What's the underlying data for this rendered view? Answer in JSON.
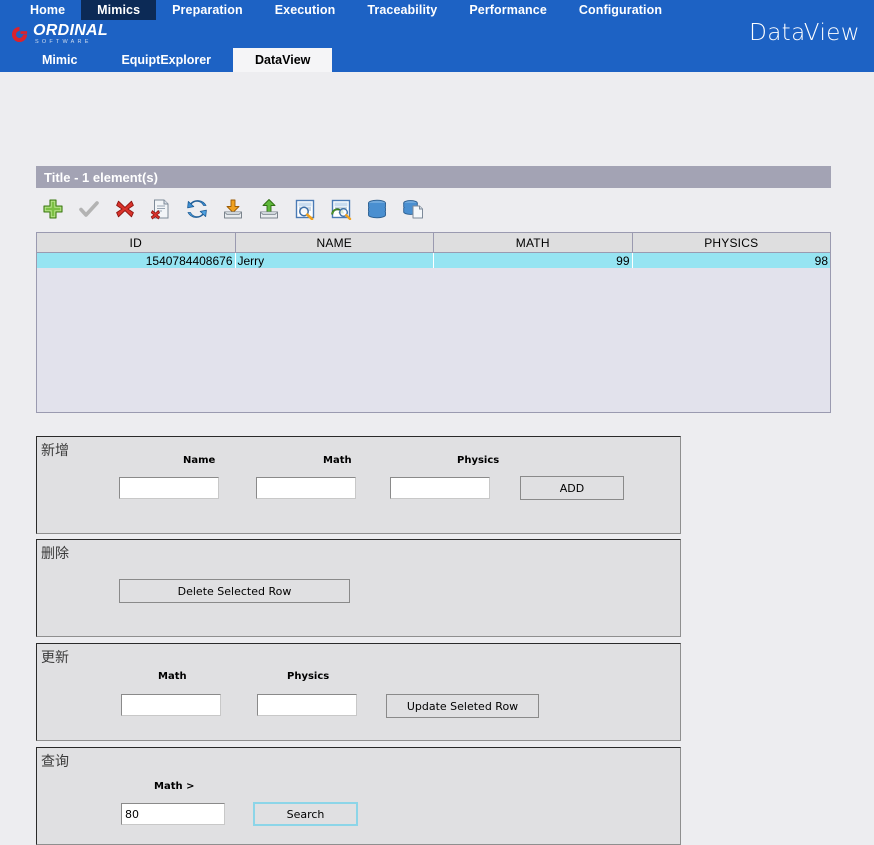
{
  "topnav": {
    "items": [
      {
        "label": "Home",
        "active": false
      },
      {
        "label": "Mimics",
        "active": true
      },
      {
        "label": "Preparation",
        "active": false
      },
      {
        "label": "Execution",
        "active": false
      },
      {
        "label": "Traceability",
        "active": false
      },
      {
        "label": "Performance",
        "active": false
      },
      {
        "label": "Configuration",
        "active": false
      }
    ]
  },
  "brand": {
    "name": "ORDINAL",
    "tagline": "SOFTWARE",
    "right_title": "DataView",
    "logo_color": "#d9232e",
    "bar_color": "#1d62c4"
  },
  "subtabs": {
    "items": [
      {
        "label": "Mimic",
        "active": false
      },
      {
        "label": "EquiptExplorer",
        "active": false
      },
      {
        "label": "DataView",
        "active": true
      }
    ]
  },
  "panel": {
    "title": "Title - 1 element(s)",
    "title_bg": "#a3a3b4"
  },
  "toolbar": {
    "icons": [
      {
        "name": "add-icon",
        "title": "Add"
      },
      {
        "name": "validate-check-icon",
        "title": "Validate"
      },
      {
        "name": "delete-cross-icon",
        "title": "Delete"
      },
      {
        "name": "delete-document-icon",
        "title": "Delete document"
      },
      {
        "name": "refresh-icon",
        "title": "Refresh"
      },
      {
        "name": "import-download-icon",
        "title": "Import"
      },
      {
        "name": "export-upload-icon",
        "title": "Export"
      },
      {
        "name": "search-document-icon",
        "title": "Search document"
      },
      {
        "name": "refresh-document-icon",
        "title": "Refresh document"
      },
      {
        "name": "database-icon",
        "title": "Database"
      },
      {
        "name": "database-copy-icon",
        "title": "Database copy"
      }
    ]
  },
  "table": {
    "columns": [
      "ID",
      "NAME",
      "MATH",
      "PHYSICS"
    ],
    "rows": [
      {
        "id": "1540784408676",
        "name": "Jerry",
        "math": "99",
        "physics": "98",
        "selected": true
      }
    ],
    "selected_row_color": "#96e4f2",
    "body_color": "#e2e2ec"
  },
  "forms": {
    "add": {
      "legend": "新增",
      "labels": {
        "name": "Name",
        "math": "Math",
        "physics": "Physics"
      },
      "values": {
        "name": "",
        "math": "",
        "physics": ""
      },
      "button": "ADD"
    },
    "delete": {
      "legend": "删除",
      "button": "Delete Selected Row"
    },
    "update": {
      "legend": "更新",
      "labels": {
        "math": "Math",
        "physics": "Physics"
      },
      "values": {
        "math": "",
        "physics": ""
      },
      "button": "Update Seleted Row"
    },
    "search": {
      "legend": "查询",
      "labels": {
        "math": "Math >"
      },
      "values": {
        "math": "80"
      },
      "button": "Search",
      "button_focused": true
    }
  }
}
